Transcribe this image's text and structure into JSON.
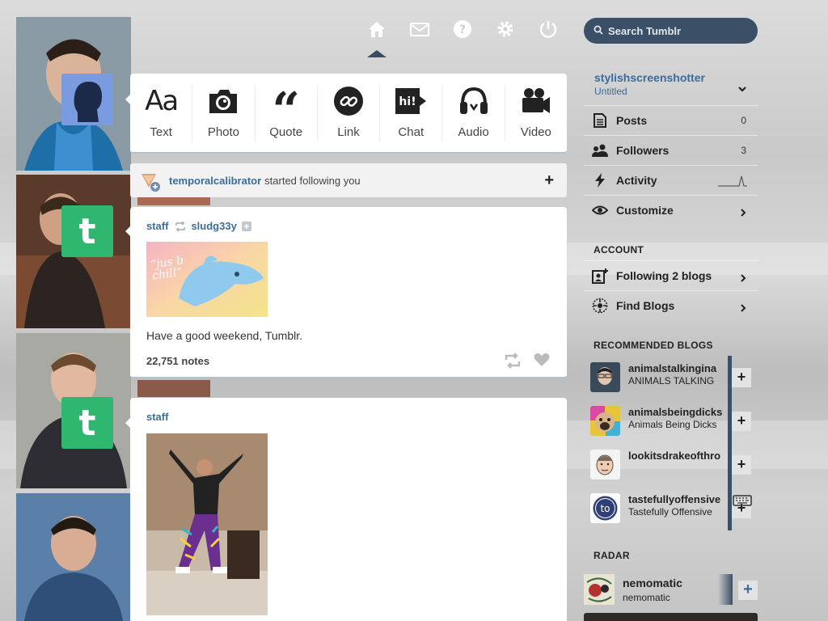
{
  "nav": {
    "icons": [
      "home-icon",
      "mail-icon",
      "help-icon",
      "settings-icon",
      "power-icon"
    ],
    "search_placeholder": "Search Tumblr"
  },
  "composer": {
    "types": [
      {
        "label": "Text",
        "icon": "text-icon"
      },
      {
        "label": "Photo",
        "icon": "camera-icon"
      },
      {
        "label": "Quote",
        "icon": "quote-icon"
      },
      {
        "label": "Link",
        "icon": "link-icon"
      },
      {
        "label": "Chat",
        "icon": "chat-icon"
      },
      {
        "label": "Audio",
        "icon": "headphones-icon"
      },
      {
        "label": "Video",
        "icon": "video-camera-icon"
      }
    ]
  },
  "notification": {
    "user": "temporalcalibrator",
    "text": "started following you"
  },
  "posts": [
    {
      "author": "staff",
      "reblogged_from": "sludg33y",
      "image_caption": "“jus b chill”",
      "body": "Have a good weekend, Tumblr.",
      "notes": "22,751 notes"
    },
    {
      "author": "staff"
    }
  ],
  "sidebar": {
    "blog_name": "stylishscreenshotter",
    "blog_title": "Untitled",
    "menu": [
      {
        "label": "Posts",
        "count": "0",
        "icon": "document-icon"
      },
      {
        "label": "Followers",
        "count": "3",
        "icon": "people-icon"
      },
      {
        "label": "Activity",
        "count": "",
        "icon": "lightning-icon"
      },
      {
        "label": "Customize",
        "count": "",
        "icon": "eye-icon"
      }
    ],
    "account_heading": "ACCOUNT",
    "account": [
      {
        "label": "Following 2 blogs",
        "icon": "add-person-icon"
      },
      {
        "label": "Find Blogs",
        "icon": "compass-icon"
      }
    ],
    "recommended_heading": "RECOMMENDED BLOGS",
    "recommended": [
      {
        "name": "animalstalkingina",
        "title": "ANIMALS TALKING"
      },
      {
        "name": "animalsbeingdicks",
        "title": "Animals Being Dicks"
      },
      {
        "name": "lookitsdrakeofthro",
        "title": ""
      },
      {
        "name": "tastefullyoffensive",
        "title": "Tastefully Offensive"
      }
    ],
    "radar_heading": "RADAR",
    "radar": {
      "name": "nemomatic",
      "title": "nemomatic"
    }
  },
  "colors": {
    "accent": "#3b6c9a",
    "nav_dark": "#3b4f66",
    "tumblr_green": "#2fb66f"
  }
}
